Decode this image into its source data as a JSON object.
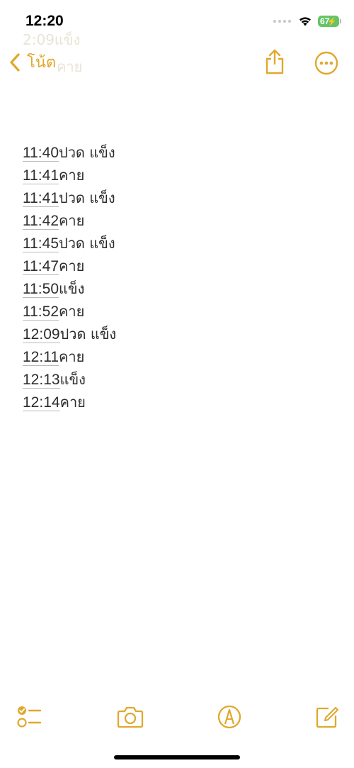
{
  "status_bar": {
    "time": "12:20",
    "battery_level": "67",
    "battery_color": "#65c466"
  },
  "background_ghost": {
    "line1": "2:09แข็ง",
    "line2": "คาย"
  },
  "nav": {
    "back_label": "โน้ต",
    "accent_color": "#e0a82e",
    "share_icon": "share-icon",
    "more_icon": "more-icon"
  },
  "note": {
    "lines": [
      {
        "time": "11:40",
        "text": "ปวด แข็ง"
      },
      {
        "time": "11:41",
        "text": "คาย"
      },
      {
        "time": "11:41",
        "text": "ปวด แข็ง"
      },
      {
        "time": "11:42",
        "text": "คาย"
      },
      {
        "time": "11:45",
        "text": "ปวด แข็ง"
      },
      {
        "time": "11:47",
        "text": "คาย"
      },
      {
        "time": "11:50",
        "text": "แข็ง"
      },
      {
        "time": "11:52",
        "text": "คาย"
      },
      {
        "time": "12:09",
        "text": "ปวด แข็ง"
      },
      {
        "time": "12:11",
        "text": "คาย"
      },
      {
        "time": "12:13",
        "text": "แข็ง"
      },
      {
        "time": "12:14",
        "text": "คาย"
      }
    ]
  },
  "toolbar": {
    "checklist_icon": "checklist-icon",
    "camera_icon": "camera-icon",
    "markup_icon": "markup-icon",
    "compose_icon": "compose-icon"
  }
}
